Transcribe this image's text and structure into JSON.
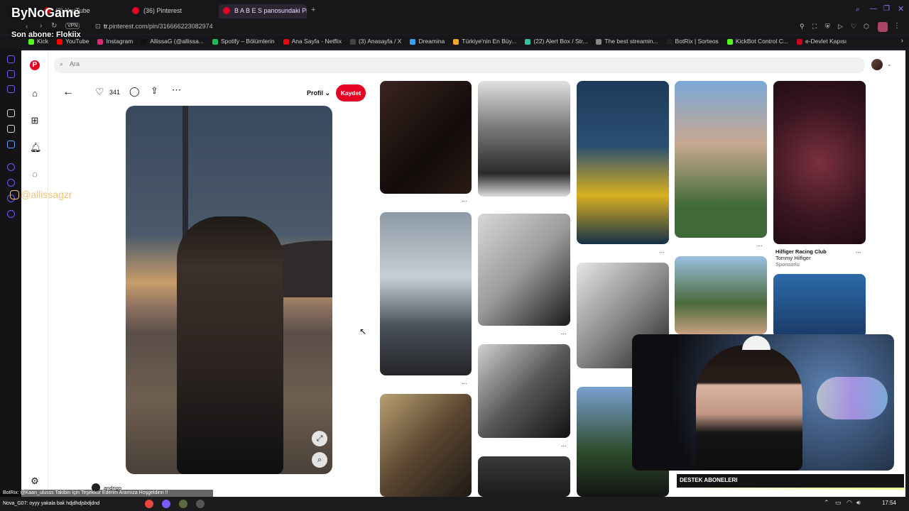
{
  "browser": {
    "tabs": [
      {
        "label": "(3) YouTube"
      },
      {
        "label": "(36) Pinterest"
      },
      {
        "label": "B A B E S panosundaki Pi"
      }
    ],
    "vpn": "VPN",
    "url_prefix": "tr.",
    "url_rest": "pinterest.com/pin/316666223082974",
    "bookmarks": [
      {
        "label": "Kick",
        "color": "#53fc18"
      },
      {
        "label": "YouTube",
        "color": "#ff0000"
      },
      {
        "label": "Instagram",
        "color": "#d62976"
      },
      {
        "label": "AllissaG (@allissa...",
        "color": "#111111"
      },
      {
        "label": "Spotify – Bölümlerin",
        "color": "#1db954"
      },
      {
        "label": "Ana Sayfa - Netflix",
        "color": "#e50914"
      },
      {
        "label": "(3) Anasayfa / X",
        "color": "#444444"
      },
      {
        "label": "Dreamina",
        "color": "#3aa0ff"
      },
      {
        "label": "Türkiye'nin En Büy...",
        "color": "#f5a623"
      },
      {
        "label": "(22) Alert Box / Str...",
        "color": "#31c3a2"
      },
      {
        "label": "The best streamin...",
        "color": "#888888"
      },
      {
        "label": "BotRix | Sorteos",
        "color": "#222222"
      },
      {
        "label": "KickBot Control C...",
        "color": "#53fc18"
      },
      {
        "label": "e-Devlet Kapısı",
        "color": "#d0021b"
      }
    ]
  },
  "overlay": {
    "channel_name": "ByNoGame",
    "last_sub": "Son abone: Flokiix",
    "instagram_handle": "@allissagzr",
    "destek_label": "DESTEK ABONELERI",
    "chat_line_1": "BotRix: @Kaan_ulusss Takibin İçin Teşekkür Ederim Aramıza Hoşgeldinn !!",
    "chat_line_2": "Nova_G07: oyyy yakala bak hdjdhdjsbdjdnd",
    "clock": "17:54"
  },
  "pinterest": {
    "search_placeholder": "Ara",
    "like_count": "341",
    "profile_label": "Profil",
    "save_label": "Kaydet",
    "pinner_name": "andrigo",
    "promo_title": "Hilfiger Racing Club",
    "promo_brand": "Tommy Hilfiger",
    "promo_tag": "Sponsorlu",
    "more_dots": "..."
  },
  "colors": {
    "brand_red": "#e60023",
    "chrome_bg": "#17171a"
  }
}
